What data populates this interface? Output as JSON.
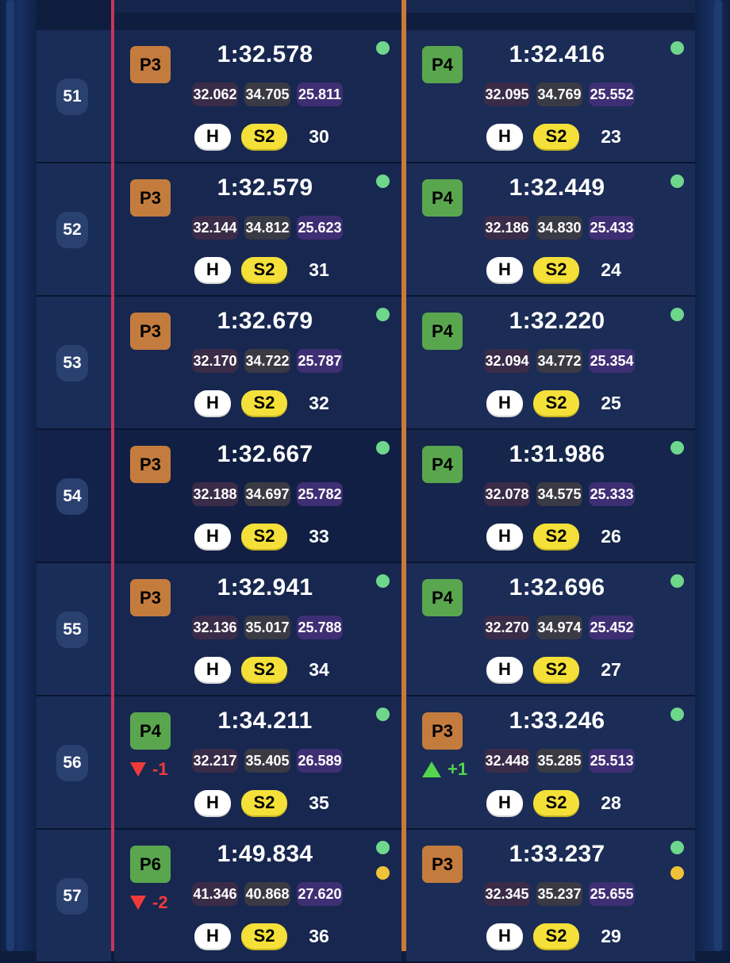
{
  "rows": [
    {
      "lap": "51",
      "left": {
        "pos": "P3",
        "pos_color": "orange",
        "delta": null,
        "time": "1:32.578",
        "s1": "32.062",
        "s2": "34.705",
        "s3": "25.811",
        "tyre": "H",
        "stint_label": "S2",
        "stint_laps": "30",
        "flags": [
          "green"
        ]
      },
      "right": {
        "pos": "P4",
        "pos_color": "green",
        "delta": null,
        "time": "1:32.416",
        "s1": "32.095",
        "s2": "34.769",
        "s3": "25.552",
        "tyre": "H",
        "stint_label": "S2",
        "stint_laps": "23",
        "flags": [
          "green"
        ]
      }
    },
    {
      "lap": "52",
      "left": {
        "pos": "P3",
        "pos_color": "orange",
        "delta": null,
        "time": "1:32.579",
        "s1": "32.144",
        "s2": "34.812",
        "s3": "25.623",
        "tyre": "H",
        "stint_label": "S2",
        "stint_laps": "31",
        "flags": [
          "green"
        ]
      },
      "right": {
        "pos": "P4",
        "pos_color": "green",
        "delta": null,
        "time": "1:32.449",
        "s1": "32.186",
        "s2": "34.830",
        "s3": "25.433",
        "tyre": "H",
        "stint_label": "S2",
        "stint_laps": "24",
        "flags": [
          "green"
        ]
      }
    },
    {
      "lap": "53",
      "left": {
        "pos": "P3",
        "pos_color": "orange",
        "delta": null,
        "time": "1:32.679",
        "s1": "32.170",
        "s2": "34.722",
        "s3": "25.787",
        "tyre": "H",
        "stint_label": "S2",
        "stint_laps": "32",
        "flags": [
          "green"
        ]
      },
      "right": {
        "pos": "P4",
        "pos_color": "green",
        "delta": null,
        "time": "1:32.220",
        "s1": "32.094",
        "s2": "34.772",
        "s3": "25.354",
        "tyre": "H",
        "stint_label": "S2",
        "stint_laps": "25",
        "flags": [
          "green"
        ]
      }
    },
    {
      "lap": "54",
      "left": {
        "pos": "P3",
        "pos_color": "orange",
        "delta": null,
        "time": "1:32.667",
        "s1": "32.188",
        "s2": "34.697",
        "s3": "25.782",
        "tyre": "H",
        "stint_label": "S2",
        "stint_laps": "33",
        "flags": [
          "green"
        ]
      },
      "right": {
        "pos": "P4",
        "pos_color": "green",
        "delta": null,
        "time": "1:31.986",
        "s1": "32.078",
        "s2": "34.575",
        "s3": "25.333",
        "tyre": "H",
        "stint_label": "S2",
        "stint_laps": "26",
        "flags": [
          "green"
        ]
      }
    },
    {
      "lap": "55",
      "left": {
        "pos": "P3",
        "pos_color": "orange",
        "delta": null,
        "time": "1:32.941",
        "s1": "32.136",
        "s2": "35.017",
        "s3": "25.788",
        "tyre": "H",
        "stint_label": "S2",
        "stint_laps": "34",
        "flags": [
          "green"
        ]
      },
      "right": {
        "pos": "P4",
        "pos_color": "green",
        "delta": null,
        "time": "1:32.696",
        "s1": "32.270",
        "s2": "34.974",
        "s3": "25.452",
        "tyre": "H",
        "stint_label": "S2",
        "stint_laps": "27",
        "flags": [
          "green"
        ]
      }
    },
    {
      "lap": "56",
      "left": {
        "pos": "P4",
        "pos_color": "green",
        "delta": {
          "dir": "down",
          "text": "-1"
        },
        "time": "1:34.211",
        "s1": "32.217",
        "s2": "35.405",
        "s3": "26.589",
        "tyre": "H",
        "stint_label": "S2",
        "stint_laps": "35",
        "flags": [
          "green"
        ]
      },
      "right": {
        "pos": "P3",
        "pos_color": "orange",
        "delta": {
          "dir": "up",
          "text": "+1"
        },
        "time": "1:33.246",
        "s1": "32.448",
        "s2": "35.285",
        "s3": "25.513",
        "tyre": "H",
        "stint_label": "S2",
        "stint_laps": "28",
        "flags": [
          "green"
        ]
      }
    },
    {
      "lap": "57",
      "left": {
        "pos": "P6",
        "pos_color": "green",
        "delta": {
          "dir": "down",
          "text": "-2"
        },
        "time": "1:49.834",
        "s1": "41.346",
        "s2": "40.868",
        "s3": "27.620",
        "tyre": "H",
        "stint_label": "S2",
        "stint_laps": "36",
        "flags": [
          "green",
          "yellow"
        ]
      },
      "right": {
        "pos": "P3",
        "pos_color": "orange",
        "delta": null,
        "time": "1:33.237",
        "s1": "32.345",
        "s2": "35.237",
        "s3": "25.655",
        "tyre": "H",
        "stint_label": "S2",
        "stint_laps": "29",
        "flags": [
          "green",
          "yellow"
        ]
      }
    }
  ],
  "colors": {
    "divider_left": "#c4375a",
    "divider_right": "#c97a3a",
    "pos_orange": "#c47c3e",
    "pos_green": "#5aa64f",
    "flag_green": "#6ed78c",
    "flag_yellow": "#f0c23a",
    "tyre_hard": "#ffffff",
    "stint_chip": "#f5e03a",
    "delta_down": "#f03a3a",
    "delta_up": "#55d44c"
  }
}
